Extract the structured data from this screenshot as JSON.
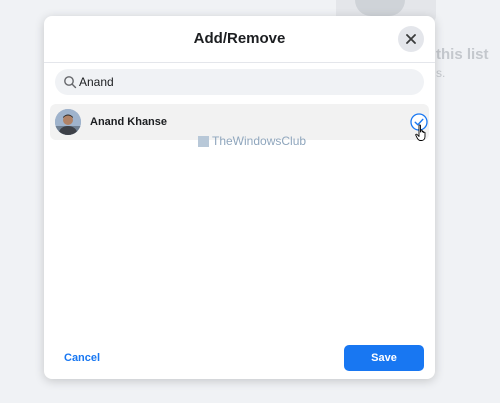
{
  "background": {
    "text_line1": "this list",
    "text_line2": "s."
  },
  "dialog": {
    "title": "Add/Remove",
    "close_icon": "close-icon",
    "search": {
      "value": "Anand",
      "placeholder": "",
      "icon": "search-icon"
    },
    "results": [
      {
        "name": "Anand Khanse",
        "selected": true,
        "icon": "check-circle-icon"
      }
    ],
    "cancel_label": "Cancel",
    "save_label": "Save"
  },
  "watermark": {
    "text": "TheWindowsClub"
  },
  "colors": {
    "accent": "#1877f2",
    "row_background": "#f2f2f2",
    "page_background": "#f0f2f5"
  }
}
